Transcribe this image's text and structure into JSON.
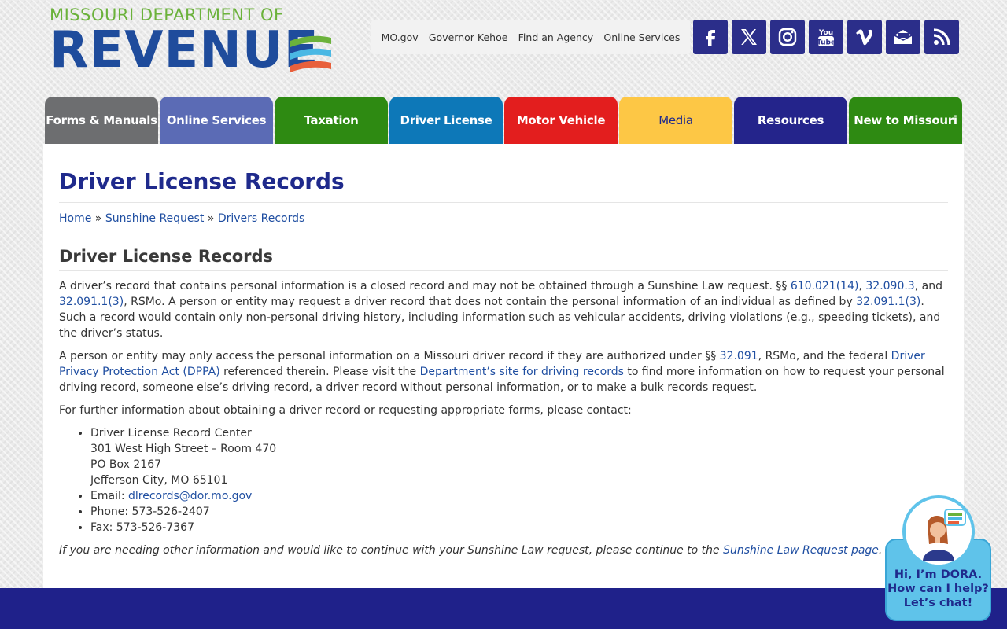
{
  "logo": {
    "top_text": "MISSOURI DEPARTMENT OF",
    "main_text": "REVENUE"
  },
  "toplinks": [
    "MO.gov",
    "Governor Kehoe",
    "Find an Agency",
    "Online Services"
  ],
  "social": [
    {
      "icon": "facebook-icon"
    },
    {
      "icon": "x-twitter-icon"
    },
    {
      "icon": "instagram-icon"
    },
    {
      "icon": "youtube-icon",
      "label_top": "You",
      "label_bottom": "Tube"
    },
    {
      "icon": "vimeo-icon"
    },
    {
      "icon": "email-subscribe-icon"
    },
    {
      "icon": "rss-icon"
    }
  ],
  "nav": [
    {
      "label": "Forms & Manuals",
      "color": "#6d6e70"
    },
    {
      "label": "Online Services",
      "color": "#5b6bb5"
    },
    {
      "label": "Taxation",
      "color": "#2e8a12"
    },
    {
      "label": "Driver License",
      "color": "#0d78b8"
    },
    {
      "label": "Motor Vehicle",
      "color": "#e31e1e"
    },
    {
      "label": "Media",
      "color": "#fdc745",
      "text_color": "#1f2a8c"
    },
    {
      "label": "Resources",
      "color": "#24248b"
    },
    {
      "label": "New to Missouri",
      "color": "#2e8a12"
    }
  ],
  "page": {
    "title": "Driver License Records",
    "breadcrumb": [
      "Home",
      "Sunshine Request",
      "Drivers Records"
    ],
    "breadcrumb_sep": "»",
    "section_title": "Driver License Records",
    "p1": {
      "t1": "A driver’s record that contains personal information is a closed record and may not be obtained through a Sunshine Law request. §§ ",
      "l1": "610.021(14)",
      "t2": ", ",
      "l2": "32.090.3",
      "t3": ", and ",
      "l3": "32.091.1(3)",
      "t4": ", RSMo. A person or entity may request a driver record that does not contain the personal information of an individual as defined by ",
      "l4": "32.091.1(3)",
      "t5": ". Such a record would contain only non-personal driving history, including information such as vehicular accidents, driving violations (e.g., speeding tickets), and the driver’s status."
    },
    "p2": {
      "t1": "A person or entity may only access the personal information on a Missouri driver record if they are authorized under §§ ",
      "l1": "32.091",
      "t2": ", RSMo, and the federal ",
      "l2": "Driver Privacy Protection Act (DPPA)",
      "t3": " referenced therein. Please visit the ",
      "l3": "Department’s site for driving records",
      "t4": " to find more information on how to request your personal driving record, someone else’s driving record, a driver record without personal information, or to make a bulk records request."
    },
    "p3": "For further information about obtaining a driver record or requesting appropriate forms, please contact:",
    "contact": {
      "name": "Driver License Record Center",
      "street": "301 West High Street – Room 470",
      "box": "PO Box 2167",
      "city": "Jefferson City, MO 65101",
      "email_label": "Email: ",
      "email": "dlrecords@dor.mo.gov",
      "phone": "Phone: 573-526-2407",
      "fax": "Fax: 573-526-7367"
    },
    "closing": {
      "t1": "If you are needing other information and would like to continue with your Sunshine Law request, please continue to the ",
      "l1": "Sunshine Law Request page",
      "t2": "."
    }
  },
  "chat": {
    "line1": "Hi, I’m DORA.",
    "line2": "How can I help?",
    "line3": "Let’s chat!"
  }
}
